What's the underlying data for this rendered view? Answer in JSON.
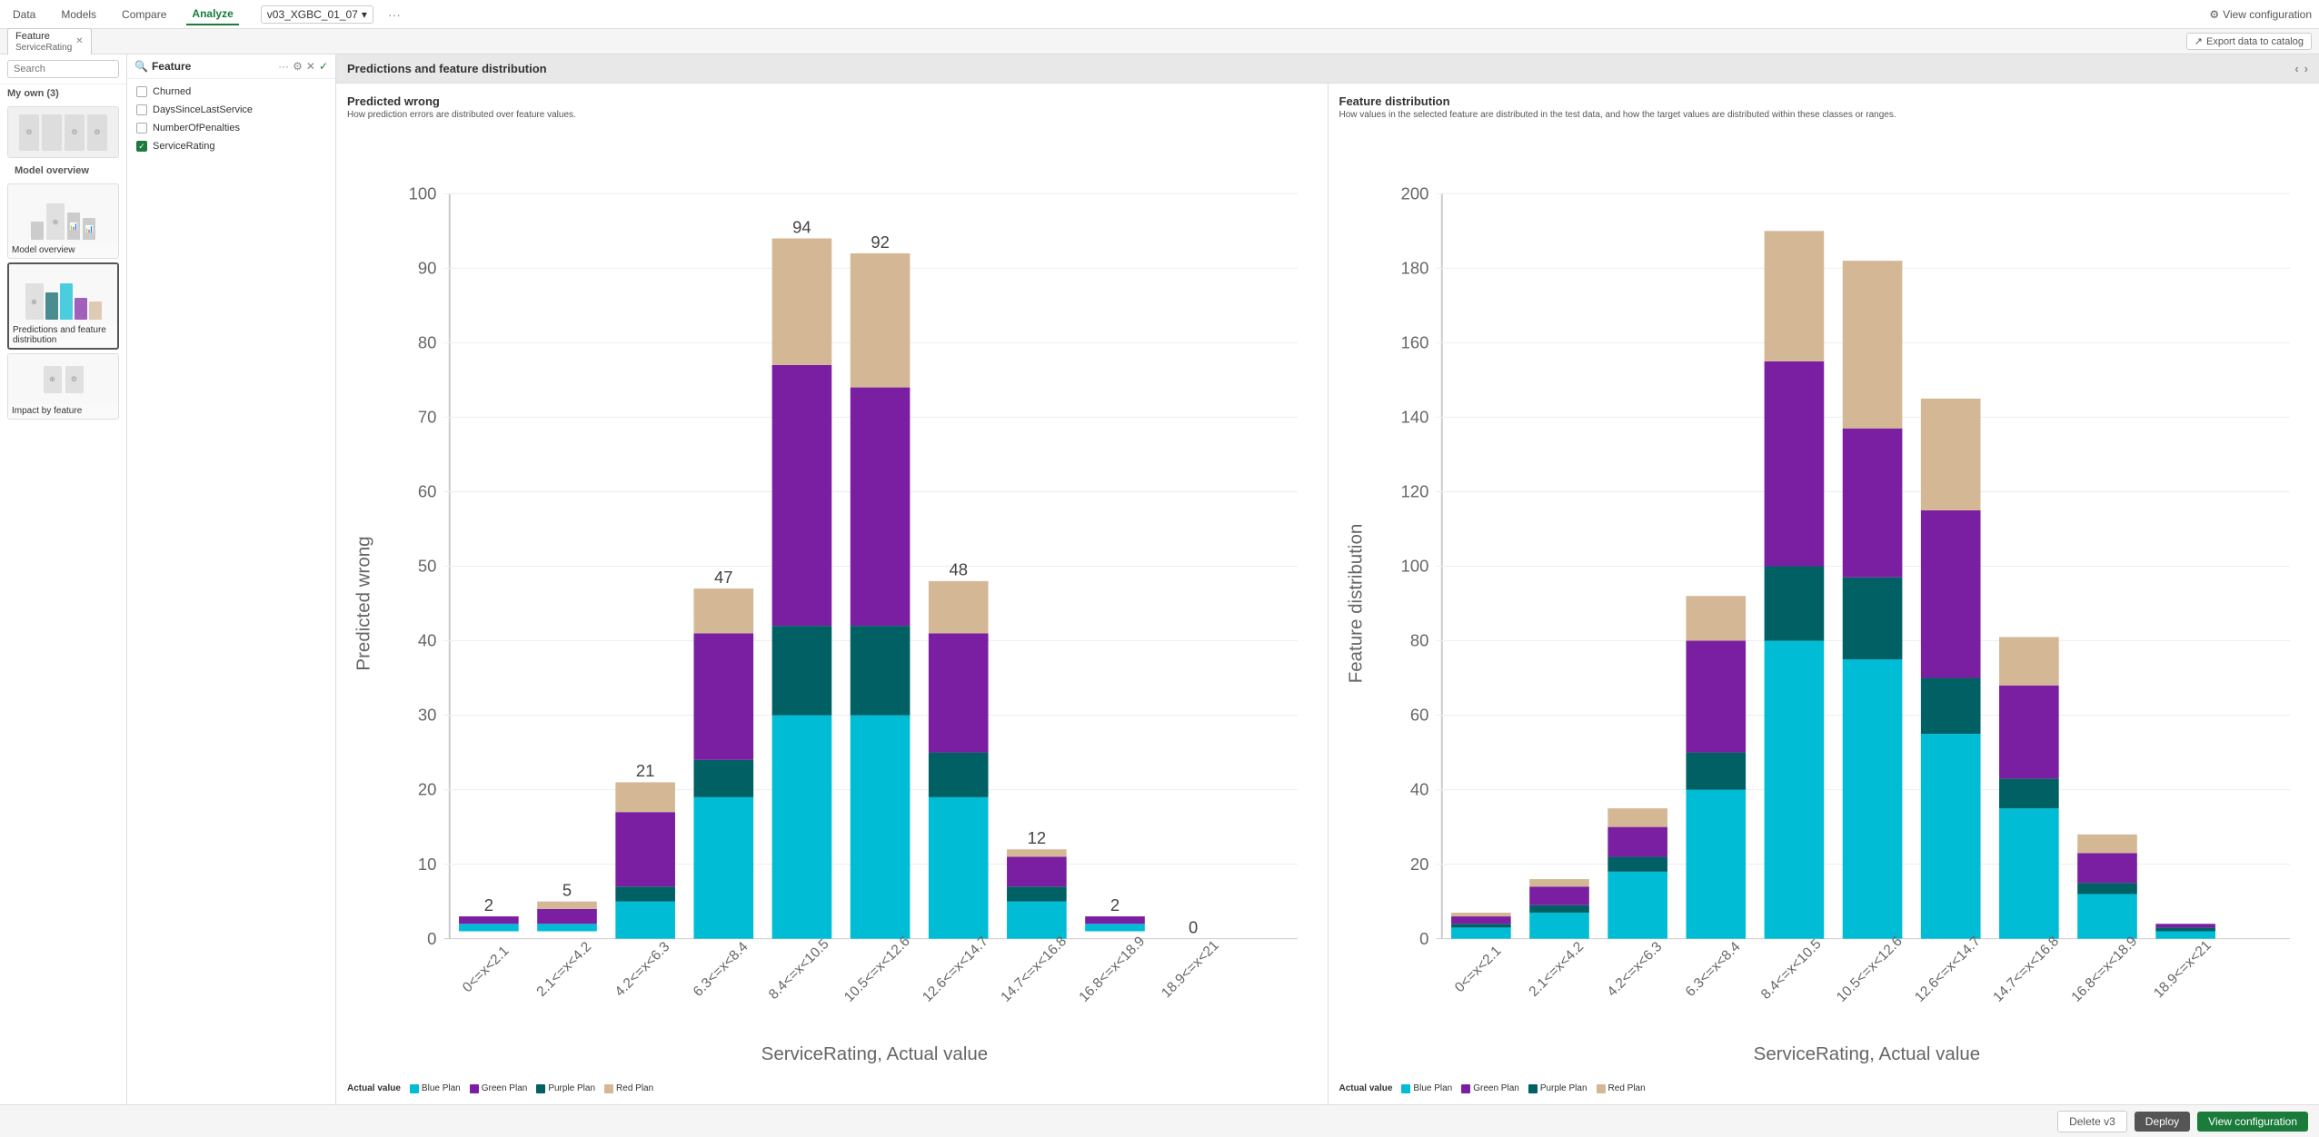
{
  "topnav": {
    "items": [
      "Data",
      "Models",
      "Compare",
      "Analyze"
    ],
    "active": "Analyze",
    "model_selector": "v03_XGBC_01_07",
    "view_config_label": "View configuration"
  },
  "tabbar": {
    "tabs": [
      {
        "label": "Feature",
        "sublabel": "ServiceRating",
        "active": true
      }
    ],
    "export_label": "Export data to catalog"
  },
  "sidebar": {
    "search_placeholder": "Search",
    "section_title": "My own (3)",
    "model_overview_label": "Model overview",
    "predictions_label": "Predictions and feature distribution",
    "impact_label": "Impact by feature"
  },
  "feature_panel": {
    "title": "Feature",
    "features": [
      {
        "name": "Churned",
        "checked": false
      },
      {
        "name": "DaysSinceLastService",
        "checked": false
      },
      {
        "name": "NumberOfPenalties",
        "checked": false
      },
      {
        "name": "ServiceRating",
        "checked": true
      }
    ]
  },
  "page_title": "Predictions and feature distribution",
  "chart_left": {
    "title": "Predicted wrong",
    "subtitle": "How prediction errors are distributed over feature values.",
    "y_label": "Predicted wrong",
    "x_label": "ServiceRating, Actual value",
    "y_max": 100,
    "x_bins": [
      "0<=x<2.1",
      "2.1<=x<4.2",
      "4.2<=x<6.3",
      "6.3<=x<8.4",
      "8.4<=x<10.5",
      "10.5<=x<12.6",
      "12.6<=x<14.7",
      "14.7<=x<16.8",
      "16.8<=x<18.9",
      "18.9<=x<21"
    ],
    "bars": [
      {
        "total": 2,
        "blue": 1,
        "green": 0,
        "purple": 1,
        "red": 0
      },
      {
        "total": 5,
        "blue": 2,
        "green": 0,
        "purple": 2,
        "red": 1
      },
      {
        "total": 21,
        "blue": 5,
        "green": 2,
        "purple": 10,
        "red": 4
      },
      {
        "total": 47,
        "blue": 19,
        "green": 5,
        "purple": 17,
        "red": 6
      },
      {
        "total": 94,
        "blue": 30,
        "green": 12,
        "purple": 35,
        "red": 17
      },
      {
        "total": 92,
        "blue": 30,
        "green": 12,
        "purple": 32,
        "red": 18
      },
      {
        "total": 48,
        "blue": 19,
        "green": 6,
        "purple": 16,
        "red": 7
      },
      {
        "total": 12,
        "blue": 5,
        "green": 2,
        "purple": 4,
        "red": 1
      },
      {
        "total": 2,
        "blue": 1,
        "green": 0,
        "purple": 1,
        "red": 0
      },
      {
        "total": 0,
        "blue": 0,
        "green": 0,
        "purple": 0,
        "red": 0
      }
    ],
    "legend": {
      "actual_value": "Actual value",
      "items": [
        "Blue Plan",
        "Green Plan",
        "Purple Plan",
        "Red Plan"
      ]
    }
  },
  "chart_right": {
    "title": "Feature distribution",
    "subtitle": "How values in the selected feature are distributed in the test data, and how the target values are distributed within these classes or ranges.",
    "y_label": "Feature distribution",
    "x_label": "ServiceRating, Actual value",
    "y_max": 200,
    "x_bins": [
      "0<=x<2.1",
      "2.1<=x<4.2",
      "4.2<=x<6.3",
      "6.3<=x<8.4",
      "8.4<=x<10.5",
      "10.5<=x<12.6",
      "12.6<=x<14.7",
      "14.7<=x<16.8",
      "16.8<=x<18.9",
      "18.9<=x<21"
    ],
    "bars": [
      {
        "blue": 3,
        "green": 1,
        "purple": 2,
        "red": 1
      },
      {
        "blue": 7,
        "green": 2,
        "purple": 5,
        "red": 2
      },
      {
        "blue": 18,
        "green": 4,
        "purple": 8,
        "red": 5
      },
      {
        "blue": 40,
        "green": 10,
        "purple": 30,
        "red": 12
      },
      {
        "blue": 80,
        "green": 20,
        "purple": 55,
        "red": 35
      },
      {
        "blue": 75,
        "green": 22,
        "purple": 40,
        "red": 45
      },
      {
        "blue": 55,
        "green": 15,
        "purple": 45,
        "red": 30
      },
      {
        "blue": 35,
        "green": 8,
        "purple": 25,
        "red": 13
      },
      {
        "blue": 12,
        "green": 3,
        "purple": 8,
        "red": 5
      },
      {
        "blue": 2,
        "green": 1,
        "purple": 1,
        "red": 0
      }
    ],
    "legend": {
      "actual_value": "Actual value",
      "items": [
        "Blue Plan",
        "Green Plan",
        "Purple Plan",
        "Red Plan"
      ]
    }
  },
  "colors": {
    "blue_plan": "#00bcd4",
    "green_plan": "#7b1fa2",
    "purple_plan": "#006064",
    "red_plan": "#d4b896",
    "active_green": "#1a7b3b",
    "checked_green": "#1a7b3b"
  },
  "bottom_bar": {
    "delete_label": "Delete v3",
    "deploy_label": "Deploy",
    "view_config_label": "View configuration"
  }
}
